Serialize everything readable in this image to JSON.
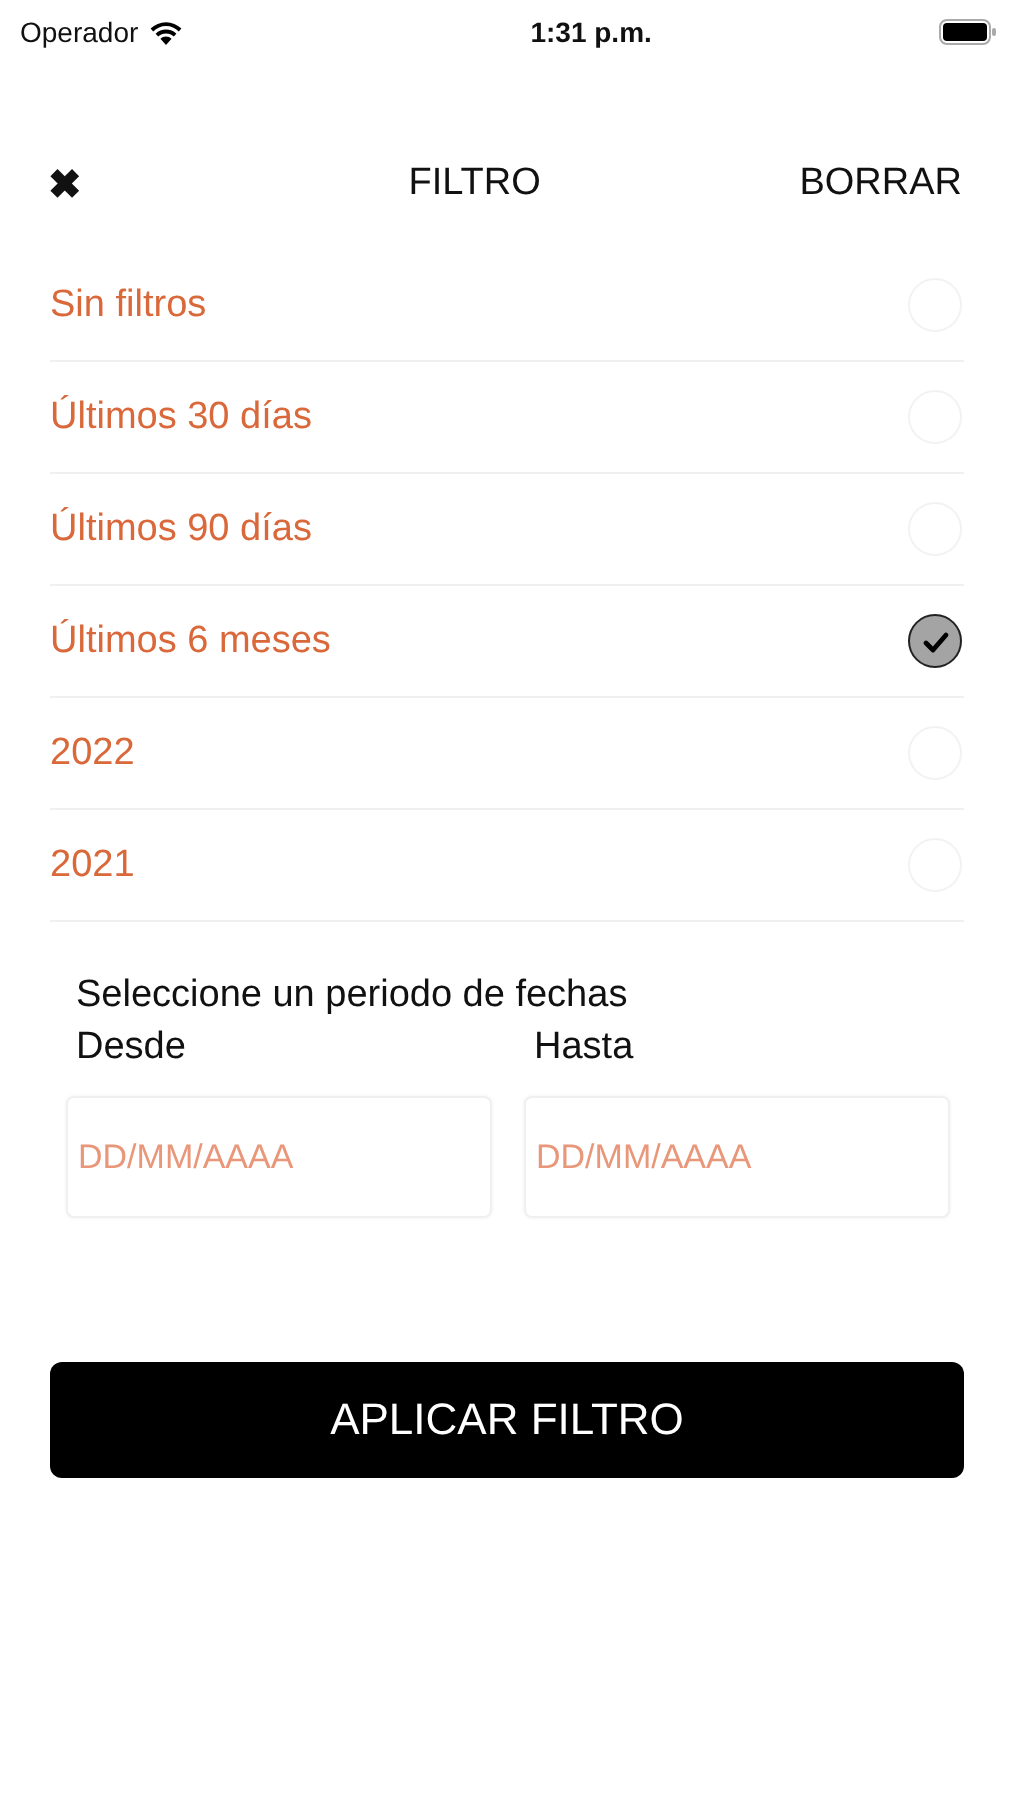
{
  "status_bar": {
    "carrier": "Operador",
    "time": "1:31 p.m."
  },
  "header": {
    "close": "✖",
    "title": "FILTRO",
    "clear": "BORRAR"
  },
  "options": [
    {
      "label": "Sin filtros",
      "selected": false
    },
    {
      "label": "Últimos 30 días",
      "selected": false
    },
    {
      "label": "Últimos 90 días",
      "selected": false
    },
    {
      "label": "Últimos 6 meses",
      "selected": true
    },
    {
      "label": "2022",
      "selected": false
    },
    {
      "label": "2021",
      "selected": false
    }
  ],
  "date_range": {
    "title": "Seleccione un periodo de fechas",
    "from": {
      "label": "Desde",
      "placeholder": "DD/MM/AAAA"
    },
    "to": {
      "label": "Hasta",
      "placeholder": "DD/MM/AAAA"
    }
  },
  "apply_button": "APLICAR FILTRO"
}
